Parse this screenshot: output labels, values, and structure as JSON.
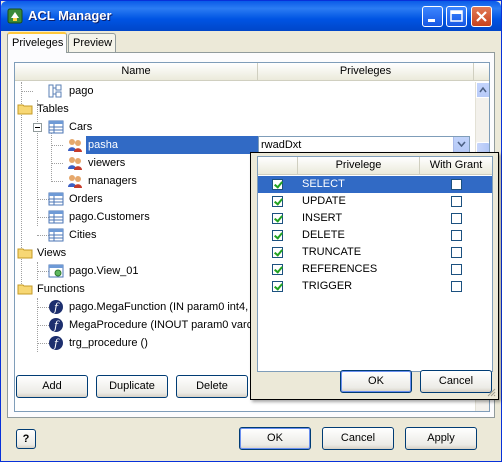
{
  "window": {
    "title": "ACL Manager"
  },
  "tabs": [
    {
      "label": "Priveleges"
    },
    {
      "label": "Preview"
    }
  ],
  "grid": {
    "headers": {
      "name": "Name",
      "priveleges": "Priveleges"
    },
    "tree": {
      "pago_schema": "pago",
      "tables": "Tables",
      "cars": "Cars",
      "pasha": "pasha",
      "viewers": "viewers",
      "managers": "managers",
      "orders": "Orders",
      "customers": "pago.Customers",
      "cities": "Cities",
      "views": "Views",
      "view01": "pago.View_01",
      "functions": "Functions",
      "megafunction": "pago.MegaFunction (IN param0 int4, IN p",
      "megaprocedure": "MegaProcedure (INOUT param0 varchar",
      "trg_procedure": "trg_procedure ()"
    },
    "selected_privileges": "rwadDxt"
  },
  "popup": {
    "headers": {
      "privelege": "Privelege",
      "with_grant": "With Grant"
    },
    "rows": [
      {
        "name": "SELECT",
        "checked": true,
        "grant": false
      },
      {
        "name": "UPDATE",
        "checked": true,
        "grant": false
      },
      {
        "name": "INSERT",
        "checked": true,
        "grant": false
      },
      {
        "name": "DELETE",
        "checked": true,
        "grant": false
      },
      {
        "name": "TRUNCATE",
        "checked": true,
        "grant": false
      },
      {
        "name": "REFERENCES",
        "checked": true,
        "grant": false
      },
      {
        "name": "TRIGGER",
        "checked": true,
        "grant": false
      }
    ],
    "ok": "OK",
    "cancel": "Cancel"
  },
  "grid_buttons": {
    "add": "Add",
    "duplicate": "Duplicate",
    "delete": "Delete"
  },
  "footer": {
    "help": "?",
    "ok": "OK",
    "cancel": "Cancel",
    "apply": "Apply"
  },
  "colors": {
    "selection": "#316ac5",
    "titlebar": "#0054e3"
  }
}
